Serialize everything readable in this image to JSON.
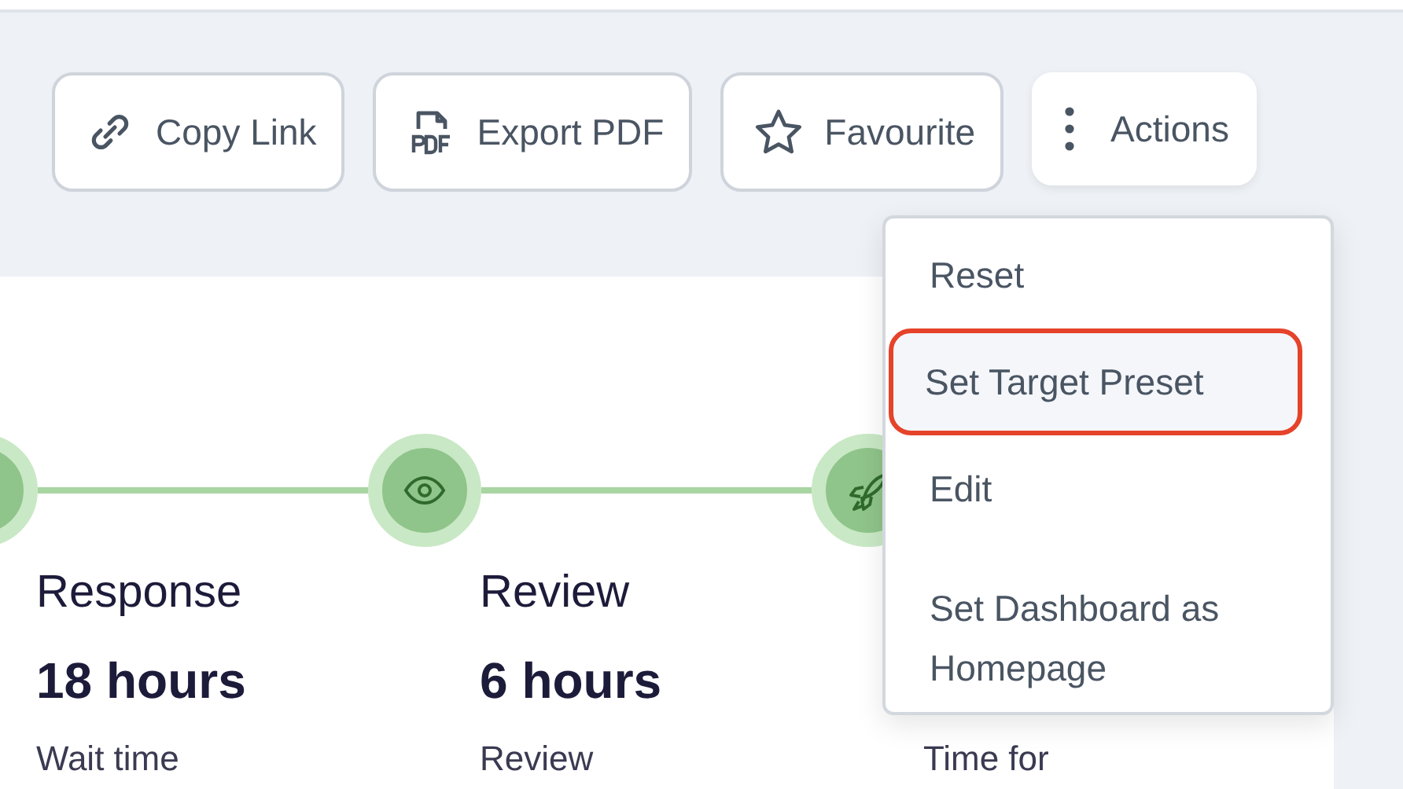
{
  "toolbar": {
    "buttons": [
      {
        "kind": "link",
        "label": "Copy Link"
      },
      {
        "kind": "pdf",
        "label": "Export PDF"
      },
      {
        "kind": "star",
        "label": "Favourite"
      },
      {
        "kind": "more",
        "label": "Actions"
      }
    ]
  },
  "timeline": {
    "stages": [
      {
        "title": "Response",
        "value": "18 hours",
        "description": "Wait time"
      },
      {
        "kind": "eye",
        "title": "Review",
        "value": "6 hours",
        "description": "Review"
      },
      {
        "kind": "rocket",
        "description": "Time for"
      }
    ]
  },
  "actions_menu": {
    "items": [
      {
        "label": "Reset",
        "highlighted": false
      },
      {
        "label": "Set Target Preset",
        "highlighted": true
      },
      {
        "label": "Edit",
        "highlighted": false
      },
      {
        "label": "Set Dashboard as Homepage",
        "highlighted": false
      }
    ]
  }
}
